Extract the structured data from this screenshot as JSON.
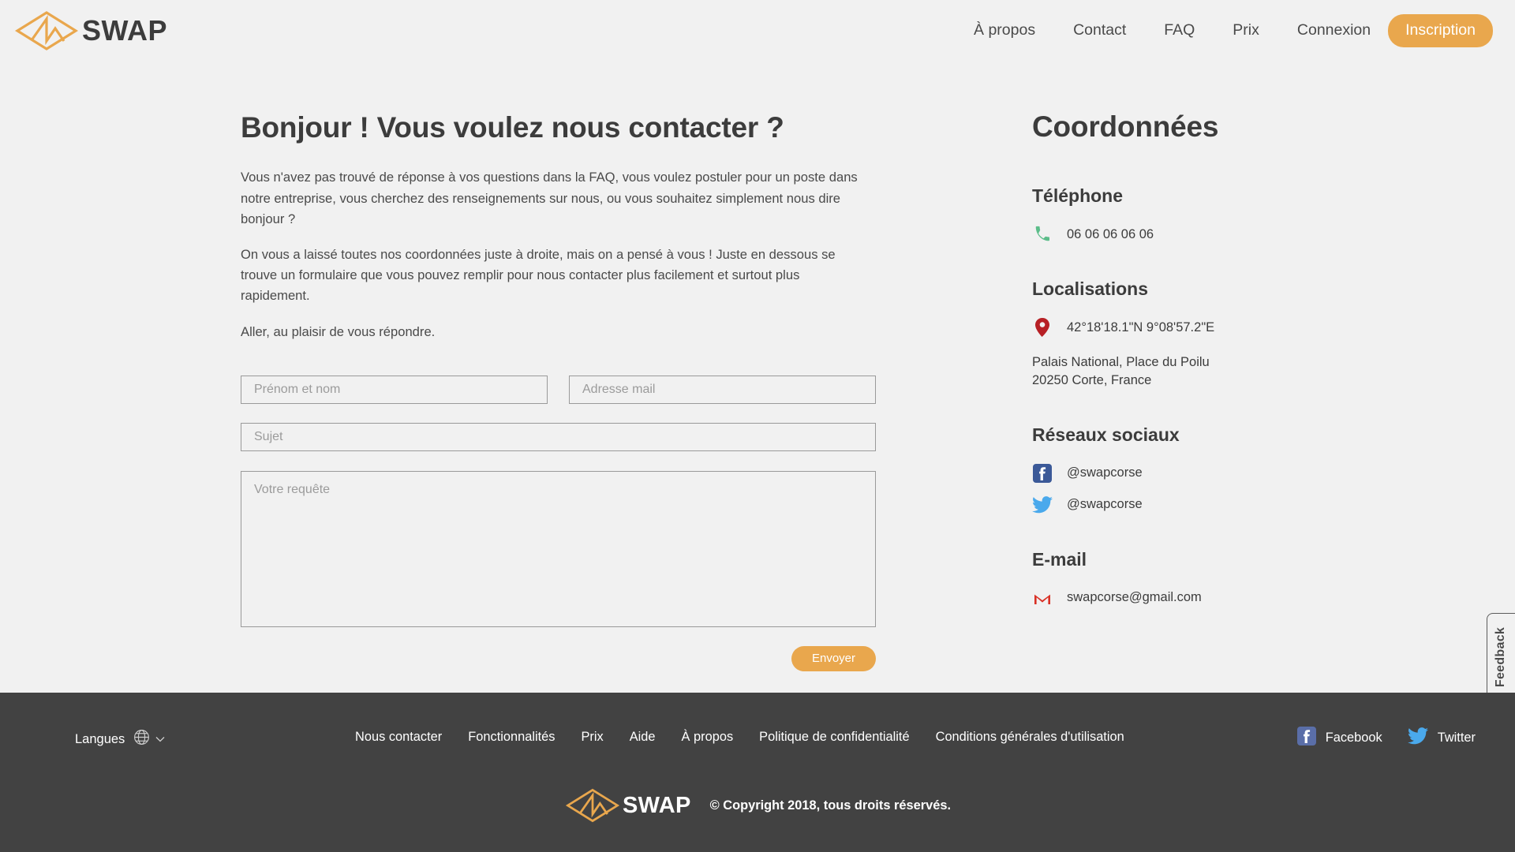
{
  "brand": {
    "name": "SWAP",
    "logo_icon": "swap-diamond-logo",
    "accent_color": "#e9a74d",
    "dark_color": "#3c3c3c",
    "page_background": "#f1f1f1",
    "footer_background": "#424242"
  },
  "header": {
    "nav": [
      {
        "label": "À propos"
      },
      {
        "label": "Contact"
      },
      {
        "label": "FAQ"
      },
      {
        "label": "Prix"
      },
      {
        "label": "Connexion"
      }
    ],
    "signup_label": "Inscription"
  },
  "main": {
    "title": "Bonjour ! Vous voulez nous contacter ?",
    "paragraphs": [
      "Vous n'avez pas trouvé de réponse à vos questions dans la FAQ, vous voulez postuler pour un poste dans notre entreprise, vous cherchez des renseignements sur nous, ou vous souhaitez simplement nous dire bonjour ?",
      "On vous a laissé toutes nos coordonnées juste à droite, mais on a pensé à vous ! Juste en dessous se trouve un formulaire que vous pouvez remplir pour nous contacter plus facilement et surtout plus rapidement.",
      "Aller, au plaisir de vous répondre."
    ],
    "form": {
      "name_placeholder": "Prénom et nom",
      "name_value": "",
      "email_placeholder": "Adresse mail",
      "email_value": "",
      "subject_placeholder": "Sujet",
      "subject_value": "",
      "message_placeholder": "Votre requête",
      "message_value": "",
      "submit_label": "Envoyer"
    }
  },
  "contact": {
    "title": "Coordonnées",
    "phone": {
      "heading": "Téléphone",
      "icon": "phone-icon",
      "icon_color": "#5cbd8a",
      "value": "06 06 06 06 06"
    },
    "location": {
      "heading": "Localisations",
      "icon": "map-pin-icon",
      "icon_color": "#b72025",
      "coordinates": "42°18'18.1\"N 9°08'57.2\"E",
      "address_line1": "Palais National, Place du Poilu",
      "address_line2": "20250 Corte, France"
    },
    "social": {
      "heading": "Réseaux sociaux",
      "items": [
        {
          "icon": "facebook-icon",
          "icon_color": "#3b5998",
          "handle": "@swapcorse"
        },
        {
          "icon": "twitter-icon",
          "icon_color": "#4aa9ec",
          "handle": "@swapcorse"
        }
      ]
    },
    "email": {
      "heading": "E-mail",
      "icon": "gmail-icon",
      "icon_color": "#d93025",
      "value": "swapcorse@gmail.com"
    }
  },
  "feedback": {
    "label": "Feedback"
  },
  "footer": {
    "languages_label": "Langues",
    "languages_icon": "globe-icon",
    "chevron_icon": "chevron-down-icon",
    "links": [
      {
        "label": "Nous contacter"
      },
      {
        "label": "Fonctionnalités"
      },
      {
        "label": "Prix"
      },
      {
        "label": "Aide"
      },
      {
        "label": "À propos"
      },
      {
        "label": "Politique de confidentialité"
      },
      {
        "label": "Conditions générales d'utilisation"
      }
    ],
    "social": [
      {
        "icon": "facebook-icon",
        "label": "Facebook",
        "icon_color": "#5a6ea8"
      },
      {
        "icon": "twitter-icon",
        "label": "Twitter",
        "icon_color": "#4aa9ec"
      }
    ],
    "brand_name": "SWAP",
    "copyright": "© Copyright 2018, tous droits réservés."
  }
}
